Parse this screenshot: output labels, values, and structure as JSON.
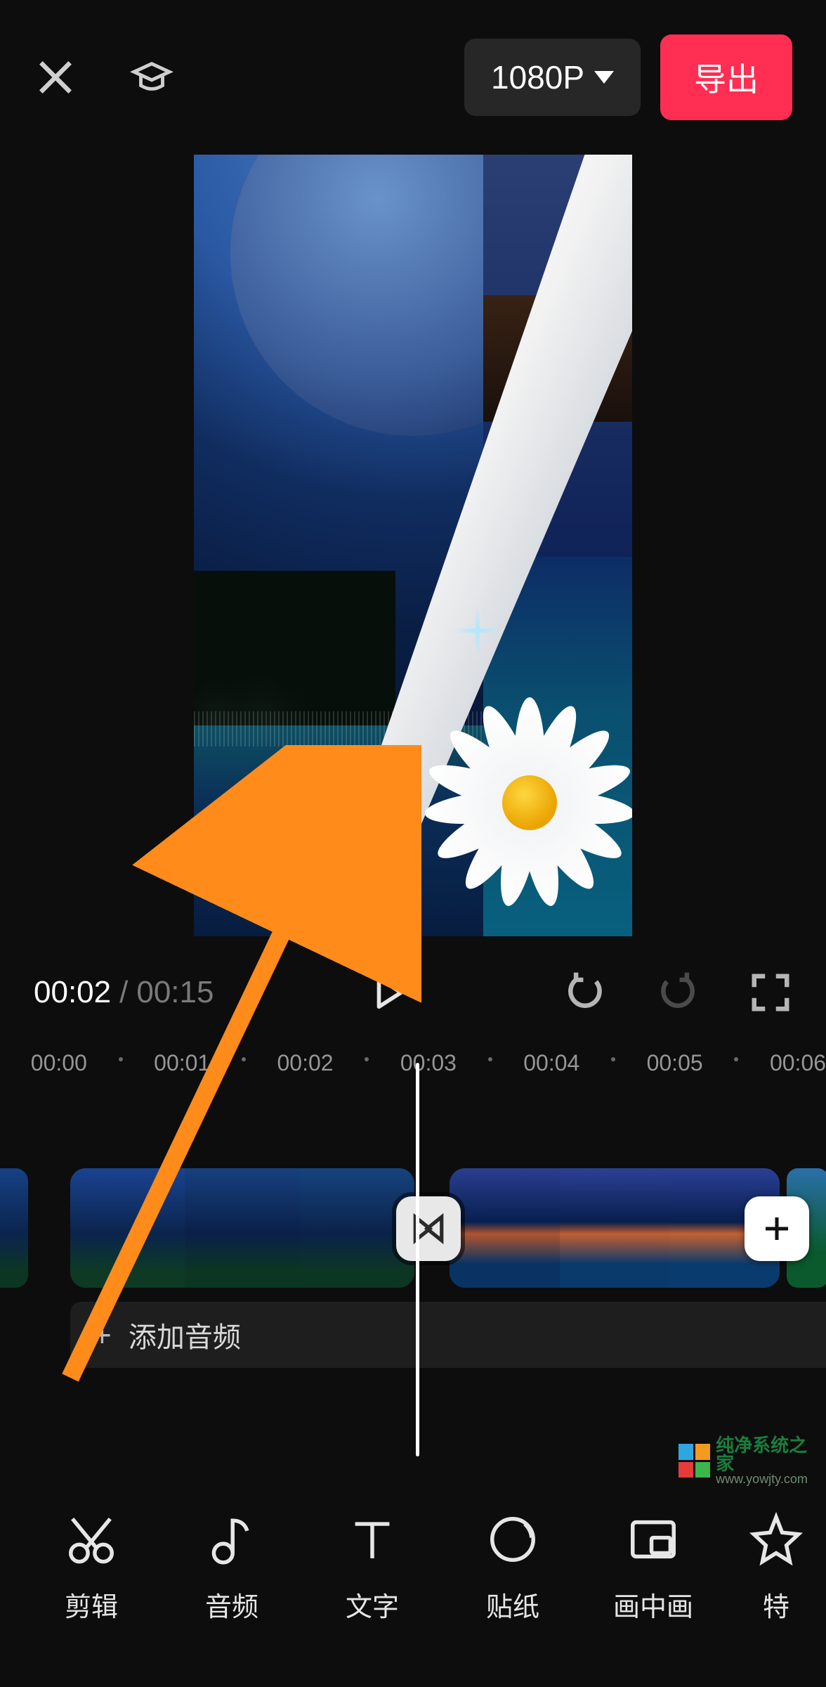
{
  "header": {
    "resolution_label": "1080P",
    "export_label": "导出"
  },
  "playback": {
    "current_time": "00:02",
    "separator": "/",
    "total_time": "00:15"
  },
  "ruler": {
    "labels": [
      "00:00",
      "00:01",
      "00:02",
      "00:03",
      "00:04",
      "00:05",
      "00:06"
    ]
  },
  "timeline": {
    "add_audio_label": "添加音频"
  },
  "tools": [
    {
      "id": "edit",
      "label": "剪辑"
    },
    {
      "id": "audio",
      "label": "音频"
    },
    {
      "id": "text",
      "label": "文字"
    },
    {
      "id": "sticker",
      "label": "贴纸"
    },
    {
      "id": "pip",
      "label": "画中画"
    },
    {
      "id": "effects",
      "label": "特"
    }
  ],
  "watermark": {
    "line1": "纯净系统之家",
    "line2": "www.yowjty.com"
  }
}
